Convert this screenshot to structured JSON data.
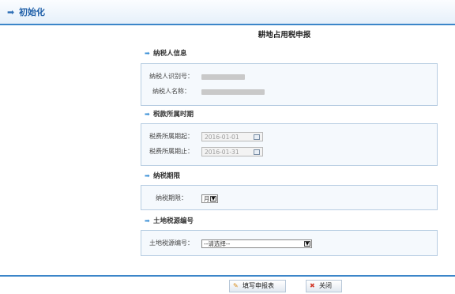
{
  "header": {
    "title": "初始化"
  },
  "form": {
    "title": "耕地占用税申报"
  },
  "sections": {
    "taxpayer": {
      "title": "纳税人信息",
      "id_label": "纳税人识别号：",
      "name_label": "纳税人名称："
    },
    "period": {
      "title": "税款所属时期",
      "start_label": "税费所属期起：",
      "start_value": "2016-01-01",
      "end_label": "税费所属期止：",
      "end_value": "2016-01-31"
    },
    "term": {
      "title": "纳税期限",
      "label": "纳税期限：",
      "selected": "月"
    },
    "land": {
      "title": "土地税源编号",
      "label": "土地税源编号：",
      "selected": "--请选择--"
    }
  },
  "footer": {
    "fill_button": "填写申报表",
    "close_button": "关闭"
  },
  "colors": {
    "accent": "#3c86c9",
    "header_text": "#1f5fa8"
  }
}
